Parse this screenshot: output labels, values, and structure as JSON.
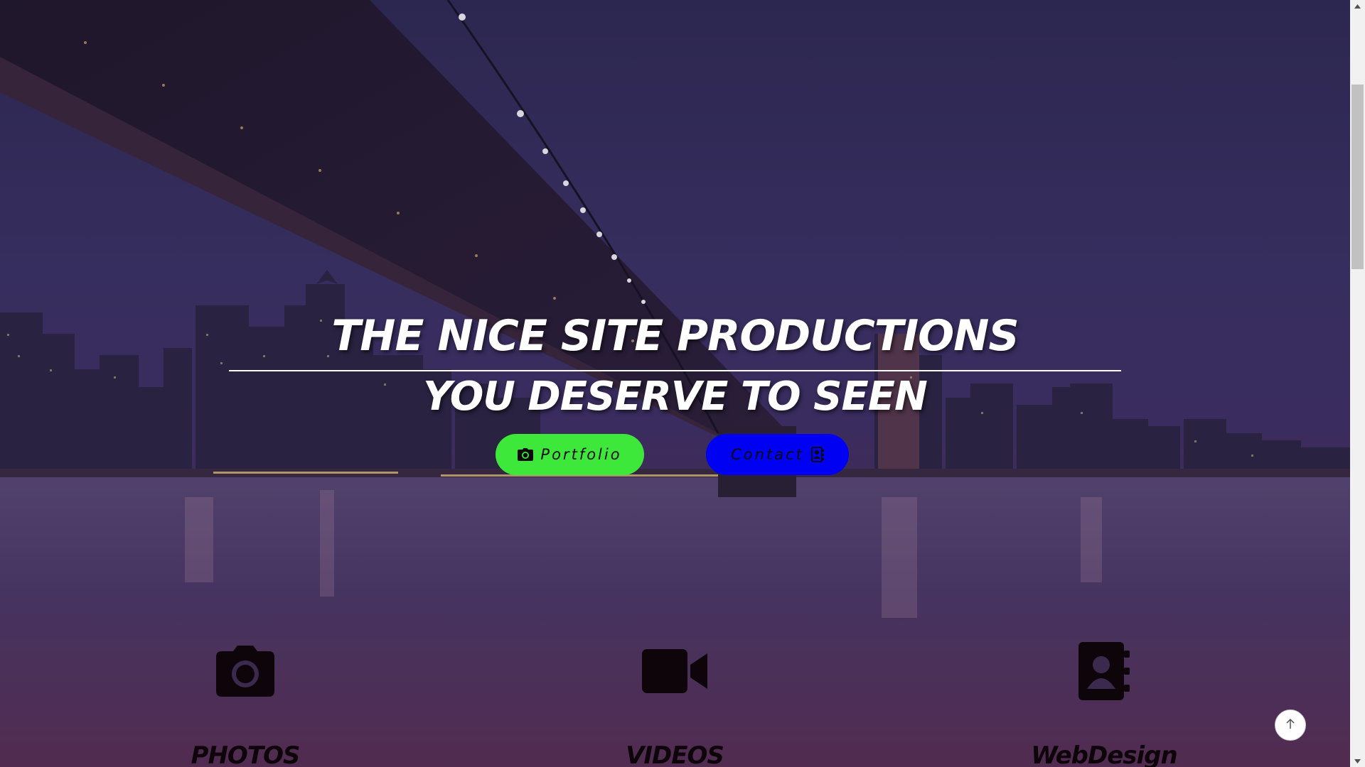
{
  "hero": {
    "title": "THE NICE SITE PRODUCTIONS",
    "subtitle": "YOU DESERVE TO SEEN"
  },
  "buttons": {
    "portfolio": {
      "label": "Portfolio",
      "color": "#3ee83a",
      "icon": "camera-icon"
    },
    "contact": {
      "label": "Contact",
      "color": "#0000f2",
      "icon": "contact-book-icon"
    }
  },
  "features": [
    {
      "label": "PHOTOS",
      "icon": "camera-icon"
    },
    {
      "label": "VIDEOS",
      "icon": "video-camera-icon"
    },
    {
      "label": "WebDesign",
      "icon": "contact-book-icon"
    }
  ],
  "back_to_top": {
    "icon": "arrow-up-icon"
  }
}
